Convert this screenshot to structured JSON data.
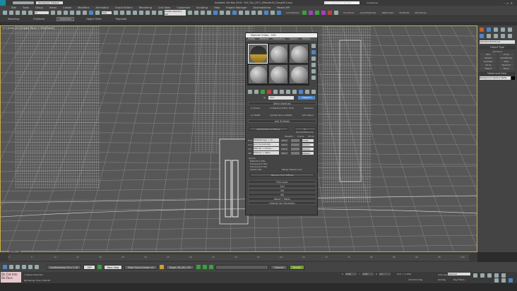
{
  "title_bar": {
    "workspace": "Workspace: Default",
    "title": "Autodesk 3ds Max 2016 - 002_City_2011_Offender03_Group001.max",
    "search_placeholder": "Type a keyword or phrase",
    "user": "multiverse"
  },
  "menu": [
    "Edit",
    "Tools",
    "Group",
    "Views",
    "Create",
    "Modifiers",
    "Animation",
    "Graph Editors",
    "Rendering",
    "Civil View",
    "Customize",
    "Scripting",
    "Help",
    "Project Manager",
    "DecimateOne",
    "Polaris MP"
  ],
  "toolbar": {
    "filter": "All",
    "view": "View",
    "selection_set": "Create Selection Set",
    "plugins": [
      "AutoModeler",
      "Grid Slicer",
      "LayerOrganizer",
      "PatternGen",
      "PeelDraw",
      "PandiLines"
    ]
  },
  "ribbon": {
    "tabs": [
      "Modeling",
      "Freeform",
      "Selection",
      "Object Paint",
      "Populate"
    ],
    "active": 2
  },
  "viewport": {
    "label": "[+] [Cam_A1] [Edged Faces + Wireframe]",
    "colors": {
      "bg": "#575757",
      "wire": "#d8d8d8"
    }
  },
  "material_editor": {
    "title": "Material Editor - Dirt",
    "menus": [
      "Modes",
      "Material",
      "Navigation",
      "Options",
      "Utilities"
    ],
    "material_name": "Dirt",
    "type_button": "VRayDirt",
    "affect": {
      "header": "Affect Materials",
      "options": [
        "In Scene",
        "In Material Editor Slots",
        "Selection"
      ],
      "row2": [
        "In VRaMt",
        "Update Now (VRaMt)",
        "Add Object"
      ]
    },
    "add_to_model": {
      "header": "Add To Model",
      "btn1": "Add/Update to Diffuse",
      "btn2": "In RenderElements",
      "columns": [
        "Weights",
        "Colors",
        "Mode"
      ],
      "layers": [
        {
          "label": "First",
          "map": "Weathering1 + Sc...",
          "weight": "100.0",
          "mode": "Cover"
        },
        {
          "label": "2nd",
          "map": "Grid (Industrial)",
          "weight": "100.0",
          "mode": "Darken"
        },
        {
          "label": "3rd",
          "map": "Wall 4K + Grime...",
          "weight": "100.0",
          "mode": "Darken"
        },
        {
          "label": "4th",
          "map": "Exterior + Wall...",
          "weight": "100.0",
          "mode": "Darken"
        }
      ],
      "ignore_header": "Ignore",
      "ignore": [
        "Reflective Hits",
        "Transparent Hits",
        "Translucent Hits",
        "Vertex Hits"
      ],
      "merge": "Merge Objects (AL)",
      "remove": "Remove from Diffuse"
    },
    "rollouts": [
      "First Layer",
      "2nd",
      "3rd",
      "4th",
      "About + Notes",
      "Internal ray Correction"
    ]
  },
  "command_panel": {
    "category": "Standard Primitives",
    "object_type": "Object Type",
    "autogrid": "AutoGrid",
    "objects": [
      "Box",
      "Cone",
      "Sphere",
      "GeoSphere",
      "Cylinder",
      "Tube",
      "Torus",
      "Pyramid",
      "Teapot",
      "Plane"
    ],
    "name_color": "Name and Color",
    "name": "Background Sphere Walls",
    "swatch": "#000000"
  },
  "timeline": {
    "frame": "0 / 100",
    "ticks": [
      "0",
      "5",
      "10",
      "15",
      "20",
      "25",
      "30",
      "35",
      "40",
      "45",
      "50",
      "55",
      "60",
      "65",
      "70",
      "75",
      "80",
      "85",
      "90",
      "95",
      "100"
    ]
  },
  "bottom": {
    "buttons": [
      "AutoBackdrop Pro v 1.18",
      "OFF",
      "Point View",
      "Make Source Brown ed",
      "Target: BA_B0_1.90",
      "Tutorials",
      "Render"
    ]
  },
  "status": {
    "maxscript": "Dir.Cat Into Dir.Face",
    "selected": "1 Object Selected",
    "render_time": "Rendering Time: 0:00:00",
    "x": "0.0M",
    "y": "0.0M",
    "z": "0.0",
    "grid": "Grid = 0.10M",
    "auto_key": "Auto Key",
    "key_mode": "Selected",
    "set_key": "Set Key",
    "key_filters": "Key Filters...",
    "time_tag": "Add Time Tag"
  }
}
